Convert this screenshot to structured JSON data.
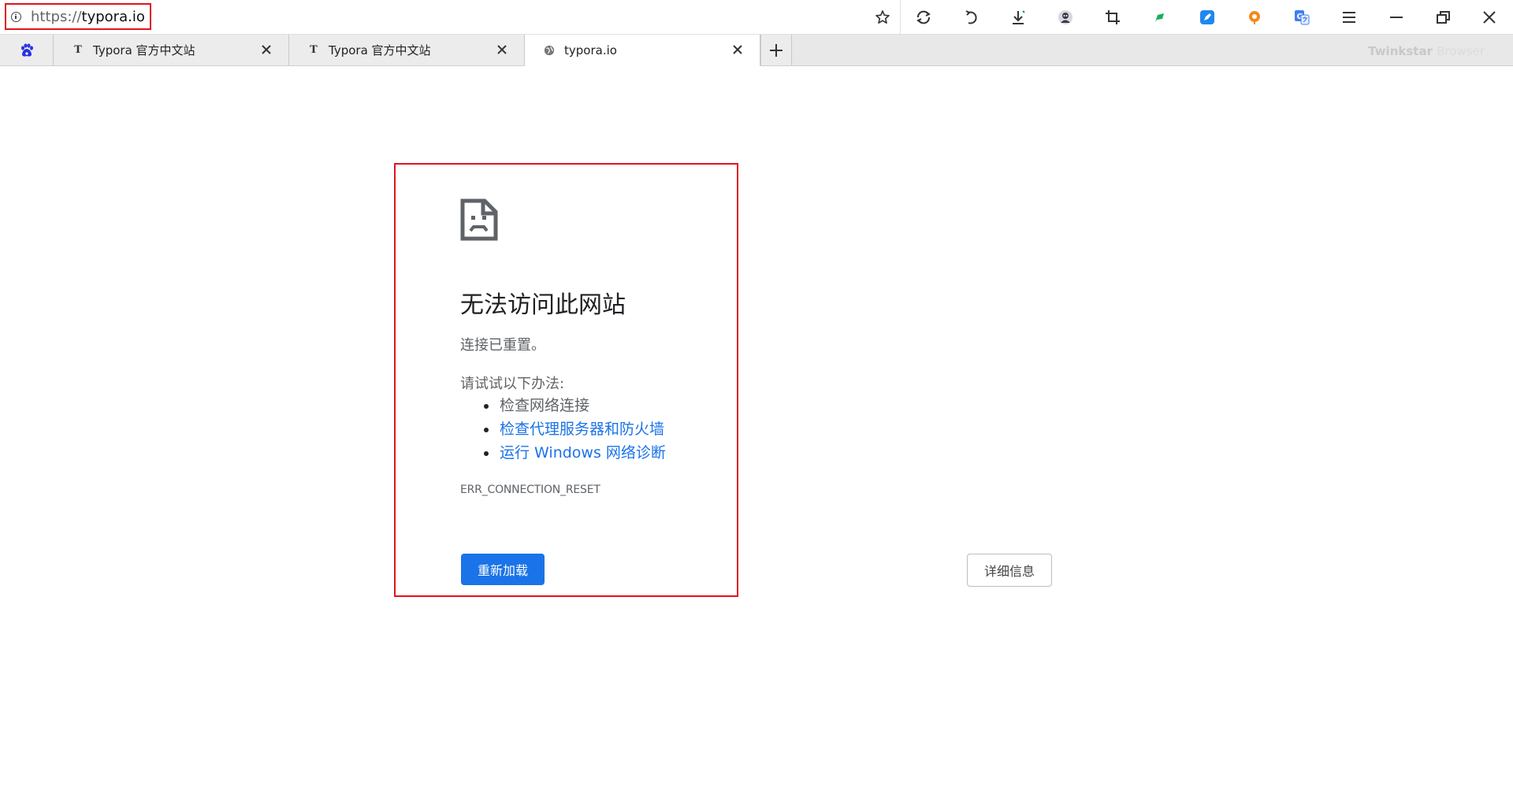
{
  "toolbar": {
    "url_scheme": "https://",
    "url_host": "typora.io",
    "icons": [
      "bookmark-star-icon",
      "sync-icon",
      "undo-icon",
      "download-icon",
      "user-avatar-icon",
      "crop-icon",
      "green-flag-extension-icon",
      "blue-note-extension-icon",
      "orange-extension-icon",
      "translate-extension-icon",
      "menu-icon",
      "minimize-icon",
      "restore-icon",
      "close-window-icon"
    ]
  },
  "tabs": [
    {
      "title": "",
      "icon": "baidu-paw-icon",
      "favicon_text": ""
    },
    {
      "title": "Typora 官方中文站",
      "favicon_text": "T"
    },
    {
      "title": "Typora 官方中文站",
      "favicon_text": "T"
    },
    {
      "title": "typora.io",
      "icon": "globe-icon",
      "active": true
    }
  ],
  "brand": {
    "bold": "Twinkstar",
    "light": "Browser"
  },
  "error": {
    "title": "无法访问此网站",
    "subtitle": "连接已重置。",
    "try_label": "请试试以下办法:",
    "suggestions": [
      "检查网络连接",
      "检查代理服务器和防火墙",
      "运行 Windows 网络诊断"
    ],
    "code": "ERR_CONNECTION_RESET",
    "reload_label": "重新加载",
    "details_label": "详细信息"
  },
  "colors": {
    "accent": "#1a73e8",
    "highlight_border": "#e0141e"
  }
}
